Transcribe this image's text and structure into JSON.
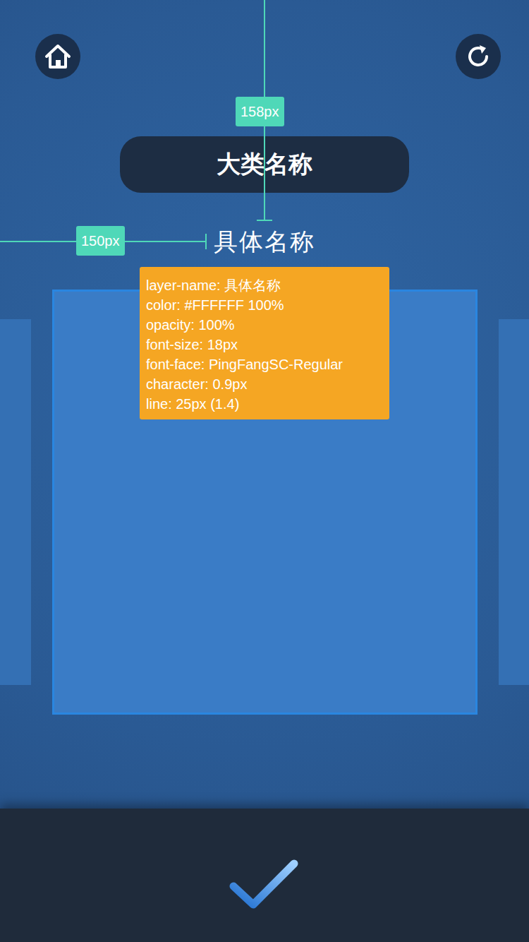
{
  "category": {
    "title": "大类名称"
  },
  "item": {
    "name": "具体名称"
  },
  "measurements": [
    {
      "label": "158px",
      "axis": "vertical"
    },
    {
      "label": "150px",
      "axis": "horizontal"
    }
  ],
  "annotation": {
    "lines": [
      "layer-name: 具体名称",
      "color: #FFFFFF 100%",
      "opacity: 100%",
      "font-size: 18px",
      "font-face: PingFangSC-Regular",
      "character: 0.9px",
      "line: 25px (1.4)"
    ]
  },
  "cards": [
    {
      "selected": false
    },
    {
      "selected": true
    },
    {
      "selected": false
    }
  ]
}
